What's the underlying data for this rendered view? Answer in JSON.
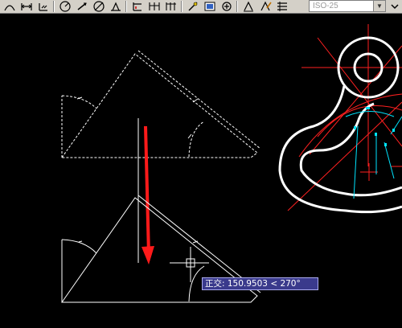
{
  "toolbar": {
    "buttons": [
      {
        "name": "arc-icon"
      },
      {
        "name": "dimension-linear-icon"
      },
      {
        "name": "ordinate-icon"
      },
      {
        "name": "radius-icon"
      },
      {
        "name": "diameter-icon"
      },
      {
        "name": "angular-icon"
      },
      {
        "name": "quick-dimension-icon"
      },
      {
        "name": "baseline-icon"
      },
      {
        "name": "continue-icon"
      },
      {
        "name": "leader-icon"
      },
      {
        "name": "tolerance-icon"
      },
      {
        "name": "center-mark-icon"
      },
      {
        "name": "dimension-edit-icon"
      },
      {
        "name": "dimension-text-edit-icon"
      },
      {
        "name": "dimension-update-icon"
      }
    ],
    "dim_style": {
      "value": "ISO-25"
    }
  },
  "tooltip": {
    "text": "正交: 150.9503 < 270°"
  },
  "colors": {
    "background": "#000000",
    "geometry": "#ffffff",
    "centerlines": "#ff2020",
    "dimensions": "#00e5ff",
    "arrow": "#ff1a1a",
    "tooltip_bg": "#3a3a8c"
  }
}
